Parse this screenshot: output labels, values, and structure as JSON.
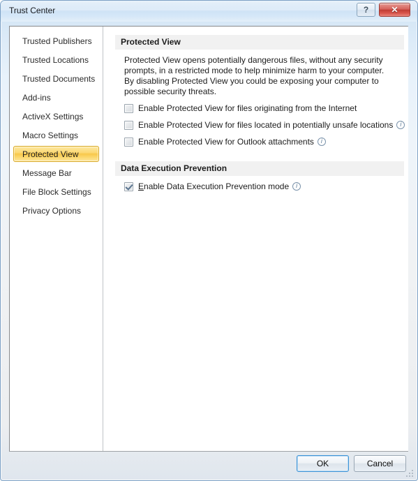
{
  "window": {
    "title": "Trust Center",
    "help_button_glyph": "?",
    "close_button_glyph": "✕"
  },
  "sidebar": {
    "items": [
      {
        "label": "Trusted Publishers",
        "selected": false
      },
      {
        "label": "Trusted Locations",
        "selected": false
      },
      {
        "label": "Trusted Documents",
        "selected": false
      },
      {
        "label": "Add-ins",
        "selected": false
      },
      {
        "label": "ActiveX Settings",
        "selected": false
      },
      {
        "label": "Macro Settings",
        "selected": false
      },
      {
        "label": "Protected View",
        "selected": true
      },
      {
        "label": "Message Bar",
        "selected": false
      },
      {
        "label": "File Block Settings",
        "selected": false
      },
      {
        "label": "Privacy Options",
        "selected": false
      }
    ]
  },
  "content": {
    "sections": [
      {
        "header": "Protected View",
        "description": "Protected View opens potentially dangerous files, without any security prompts, in a restricted mode to help minimize harm to your computer. By disabling Protected View you could be exposing your computer to possible security threats.",
        "options": [
          {
            "label": "Enable Protected View for files originating from the Internet",
            "checked": false,
            "info": false
          },
          {
            "label": "Enable Protected View for files located in potentially unsafe locations",
            "checked": false,
            "info": true
          },
          {
            "label": "Enable Protected View for Outlook attachments",
            "checked": false,
            "info": true
          }
        ]
      },
      {
        "header": "Data Execution Prevention",
        "description": "",
        "options": [
          {
            "label": "Enable Data Execution Prevention mode",
            "accelerator": "E",
            "label_rest": "nable Data Execution Prevention mode",
            "checked": true,
            "info": true
          }
        ]
      }
    ]
  },
  "footer": {
    "ok_label": "OK",
    "cancel_label": "Cancel"
  },
  "colors": {
    "selected_accent": "#f8c84b",
    "selected_border": "#d9a823",
    "close_button": "#c03d35",
    "focus_border": "#3d93d6",
    "section_header_bg": "#f1f1f1"
  }
}
